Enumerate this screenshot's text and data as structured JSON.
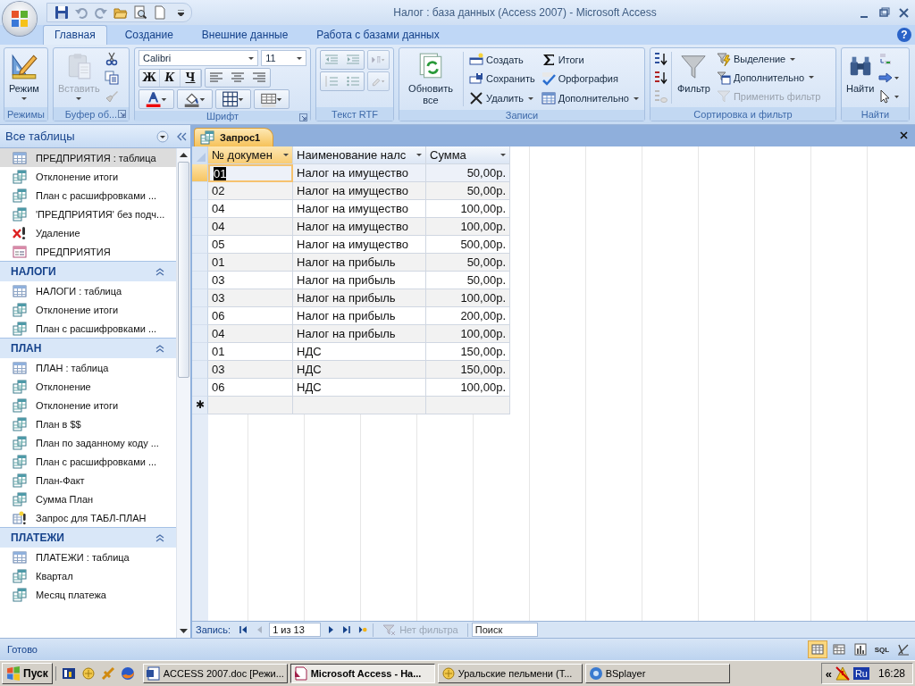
{
  "window": {
    "title": "Налог : база данных (Access 2007) - Microsoft Access"
  },
  "ribbon_tabs": [
    {
      "label": "Главная",
      "selected": true
    },
    {
      "label": "Создание",
      "selected": false
    },
    {
      "label": "Внешние данные",
      "selected": false
    },
    {
      "label": "Работа с базами данных",
      "selected": false
    }
  ],
  "help": "?",
  "ribbon_groups": [
    {
      "label": "Режимы",
      "buttons": [
        {
          "label": "Режим",
          "disabled": false
        }
      ]
    },
    {
      "label": "Буфер об...",
      "buttons": [
        {
          "label": "Вставить",
          "disabled": true
        }
      ]
    },
    {
      "label": "Шрифт",
      "font": "Calibri",
      "size": "11",
      "buttons": [
        {
          "label": "Ж",
          "disabled": false
        },
        {
          "label": "К",
          "disabled": false
        },
        {
          "label": "Ч",
          "disabled": false
        }
      ]
    },
    {
      "label": "Текст RTF"
    },
    {
      "label": "Записи",
      "buttons": [
        {
          "label": "Обновить все",
          "disabled": false
        },
        {
          "label": "Создать",
          "disabled": false
        },
        {
          "label": "Сохранить",
          "disabled": false
        },
        {
          "label": "Удалить",
          "disabled": false
        },
        {
          "label": "Итоги",
          "disabled": false
        },
        {
          "label": "Орфография",
          "disabled": false
        },
        {
          "label": "Дополнительно",
          "disabled": false
        }
      ]
    },
    {
      "label": "Сортировка и фильтр",
      "buttons": [
        {
          "label": "Фильтр",
          "disabled": false
        },
        {
          "label": "Выделение",
          "disabled": false
        },
        {
          "label": "Дополнительно",
          "disabled": false
        },
        {
          "label": "Применить фильтр",
          "disabled": true
        }
      ]
    },
    {
      "label": "Найти",
      "buttons": [
        {
          "label": "Найти",
          "disabled": false
        }
      ]
    }
  ],
  "nav_pane": {
    "title": "Все таблицы",
    "groups": [
      {
        "items": [
          {
            "label": "ПРЕДПРИЯТИЯ : таблица",
            "kind": "table",
            "selected": true
          },
          {
            "label": "Отклонение итоги",
            "kind": "query",
            "selected": false
          },
          {
            "label": "План с расшифровками ...",
            "kind": "query",
            "selected": false
          },
          {
            "label": "'ПРЕДПРИЯТИЯ' без подч...",
            "kind": "query",
            "selected": false
          },
          {
            "label": "Удаление",
            "kind": "delete_query",
            "selected": false
          },
          {
            "label": "ПРЕДПРИЯТИЯ",
            "kind": "form",
            "selected": false
          }
        ]
      },
      {
        "title": "НАЛОГИ",
        "expanded": true,
        "items": [
          {
            "label": "НАЛОГИ : таблица",
            "kind": "table",
            "selected": false
          },
          {
            "label": "Отклонение итоги",
            "kind": "query",
            "selected": false
          },
          {
            "label": "План с расшифровками ...",
            "kind": "query",
            "selected": false
          }
        ]
      },
      {
        "title": "ПЛАН",
        "expanded": true,
        "items": [
          {
            "label": "ПЛАН : таблица",
            "kind": "table",
            "selected": false
          },
          {
            "label": "Отклонение",
            "kind": "query",
            "selected": false
          },
          {
            "label": "Отклонение итоги",
            "kind": "query",
            "selected": false
          },
          {
            "label": "План в $$",
            "kind": "query",
            "selected": false
          },
          {
            "label": "План по заданному коду ...",
            "kind": "query",
            "selected": false
          },
          {
            "label": "План с расшифровками ...",
            "kind": "query",
            "selected": false
          },
          {
            "label": "План-Факт",
            "kind": "query",
            "selected": false
          },
          {
            "label": "Сумма План",
            "kind": "query",
            "selected": false
          },
          {
            "label": "Запрос для ТАБЛ-ПЛАН",
            "kind": "append_query",
            "selected": false
          }
        ]
      },
      {
        "title": "ПЛАТЕЖИ",
        "expanded": true,
        "items": [
          {
            "label": "ПЛАТЕЖИ : таблица",
            "kind": "table",
            "selected": false
          },
          {
            "label": "Квартал",
            "kind": "query",
            "selected": false
          },
          {
            "label": "Месяц платежа",
            "kind": "query",
            "selected": false
          }
        ]
      }
    ]
  },
  "document_tabs": [
    {
      "label": "Запрос1",
      "selected": true
    }
  ],
  "datasheet": {
    "columns": [
      {
        "label": "№ докумен",
        "kind": "text",
        "selected": true
      },
      {
        "label": "Наименование налс",
        "kind": "text",
        "selected": false
      },
      {
        "label": "Сумма",
        "kind": "currency",
        "selected": false
      }
    ],
    "rows": [
      {
        "selected": true,
        "cells": [
          "01",
          "Налог на имущество",
          "50,00р."
        ]
      },
      {
        "selected": false,
        "cells": [
          "02",
          "Налог на имущество",
          "50,00р."
        ]
      },
      {
        "selected": false,
        "cells": [
          "04",
          "Налог на имущество",
          "100,00р."
        ]
      },
      {
        "selected": false,
        "cells": [
          "04",
          "Налог на имущество",
          "100,00р."
        ]
      },
      {
        "selected": false,
        "cells": [
          "05",
          "Налог на имущество",
          "500,00р."
        ]
      },
      {
        "selected": false,
        "cells": [
          "01",
          "Налог на прибыль",
          "50,00р."
        ]
      },
      {
        "selected": false,
        "cells": [
          "03",
          "Налог на прибыль",
          "50,00р."
        ]
      },
      {
        "selected": false,
        "cells": [
          "03",
          "Налог на прибыль",
          "100,00р."
        ]
      },
      {
        "selected": false,
        "cells": [
          "06",
          "Налог на прибыль",
          "200,00р."
        ]
      },
      {
        "selected": false,
        "cells": [
          "04",
          "Налог на прибыль",
          "100,00р."
        ]
      },
      {
        "selected": false,
        "cells": [
          "01",
          "НДС",
          "150,00р."
        ]
      },
      {
        "selected": false,
        "cells": [
          "03",
          "НДС",
          "150,00р."
        ]
      },
      {
        "selected": false,
        "cells": [
          "06",
          "НДС",
          "100,00р."
        ]
      }
    ],
    "new_row_marker": "✱"
  },
  "record_nav": {
    "label": "Запись:",
    "position": "1 из 13",
    "filter": {
      "label": "Нет фильтра",
      "disabled": true
    },
    "search": {
      "placeholder": "Поиск"
    }
  },
  "status_bar": {
    "text": "Готово",
    "views": [
      {
        "kind": "datasheet",
        "selected": true
      },
      {
        "kind": "pivot_table",
        "selected": false
      },
      {
        "kind": "pivot_chart",
        "selected": false
      },
      {
        "kind": "sql",
        "label": "SQL",
        "selected": false
      },
      {
        "kind": "design",
        "selected": false
      }
    ]
  },
  "taskbar": {
    "start": "Пуск",
    "tasks": [
      {
        "label": "ACCESS 2007.doc [Режи...",
        "kind": "word",
        "selected": false
      },
      {
        "label": "Microsoft Access - На...",
        "kind": "access",
        "selected": true
      },
      {
        "label": "Уральские пельмени (Т...",
        "kind": "folder",
        "selected": false
      },
      {
        "label": "BSplayer",
        "kind": "player",
        "selected": false
      }
    ],
    "tray": {
      "expand": "«",
      "language": "Ru",
      "clock": "16:28"
    }
  }
}
